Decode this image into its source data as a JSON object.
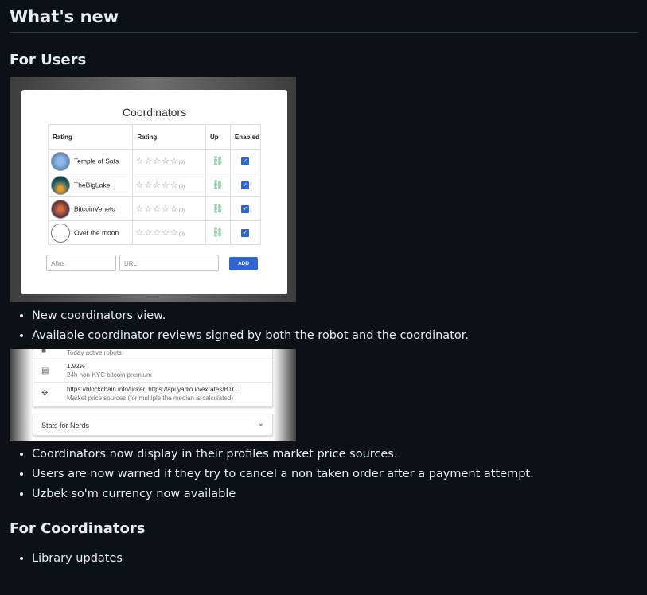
{
  "page": {
    "title": "What's new",
    "section_users": "For Users",
    "section_coordinators": "For Coordinators"
  },
  "shot1": {
    "dialog_title": "Coordinators",
    "headers": [
      "Rating",
      "Rating",
      "Up",
      "Enabled"
    ],
    "rows": [
      {
        "name": "Temple of Sats",
        "count": "(0)"
      },
      {
        "name": "TheBigLake",
        "count": "(0)"
      },
      {
        "name": "BitcoinVeneto",
        "count": "(0)"
      },
      {
        "name": "Over the moon",
        "count": "(0)"
      }
    ],
    "alias_placeholder": "Alias",
    "url_placeholder": "URL",
    "add_label": "ADD",
    "star_glyphs": "☆☆☆☆☆",
    "link_glyph": "⛓",
    "check_glyph": "✓"
  },
  "list1": [
    "New coordinators view.",
    "Available coordinator reviews signed by both the robot and the coordinator."
  ],
  "shot2": {
    "row1_sub": "Today active robots",
    "row2_main": "1.92%",
    "row2_sub": "24h non-KYC bitcoin premium",
    "row3_main": "https://blockchain.info/ticker, https://api.yadio.io/exrates/BTC",
    "row3_sub": "Market price sources (for multiple the median is calculated)",
    "stats_label": "Stats for Nerds"
  },
  "list2": [
    "Coordinators now display in their profiles market price sources.",
    "Users are now warned if they try to cancel a non taken order after a payment attempt.",
    "Uzbek so'm currency now available"
  ],
  "list3": [
    "Library updates"
  ]
}
